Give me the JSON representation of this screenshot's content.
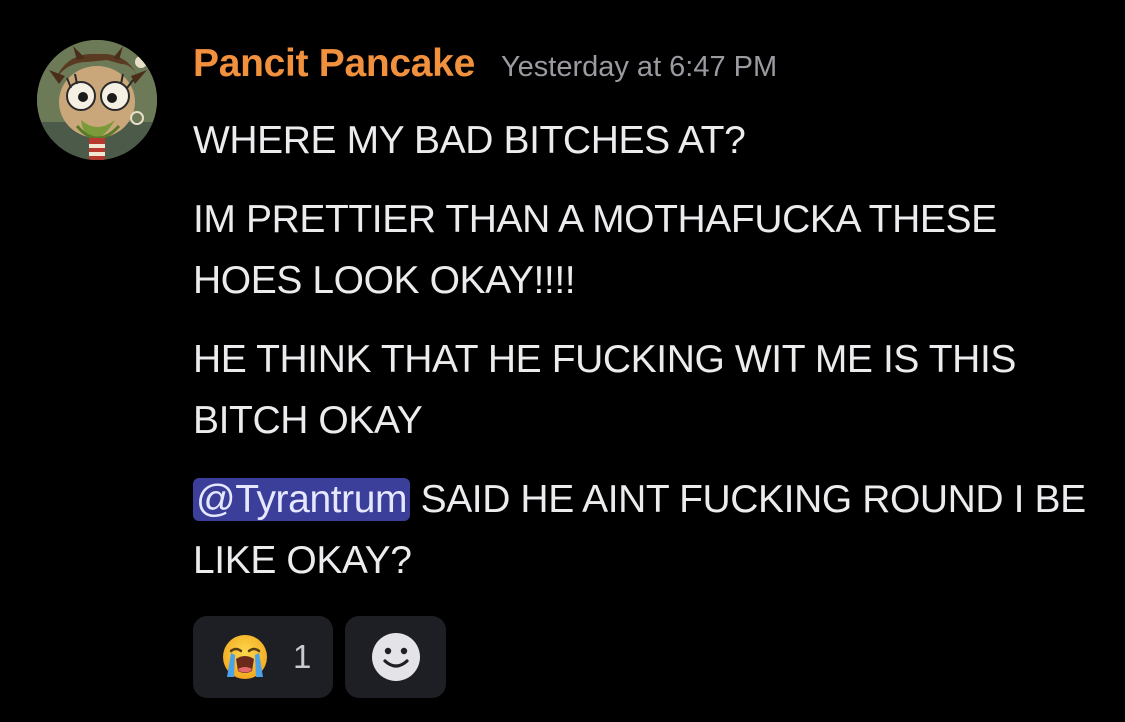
{
  "message": {
    "author": {
      "name": "Pancit Pancake",
      "name_color": "#f2913d",
      "avatar": "cartoon-character-avatar"
    },
    "timestamp": "Yesterday at 6:47 PM",
    "lines": [
      "WHERE MY BAD BITCHES AT?",
      "IM PRETTIER THAN A MOTHAFUCKA THESE HOES LOOK OKAY!!!!",
      "HE THINK THAT HE FUCKING WIT ME IS THIS BITCH OKAY"
    ],
    "last_line": {
      "mention": "@Tyrantrum",
      "text": " SAID HE AINT FUCKING ROUND I BE LIKE OKAY?"
    }
  },
  "reactions": [
    {
      "emoji": "loudly-crying-face-icon",
      "count": "1"
    }
  ],
  "add_reaction_icon": "smiley-face-icon",
  "colors": {
    "background": "#000000",
    "mention_bg": "#3b3f99",
    "reaction_bg": "#1e1f24",
    "timestamp": "#9a9aa0"
  }
}
